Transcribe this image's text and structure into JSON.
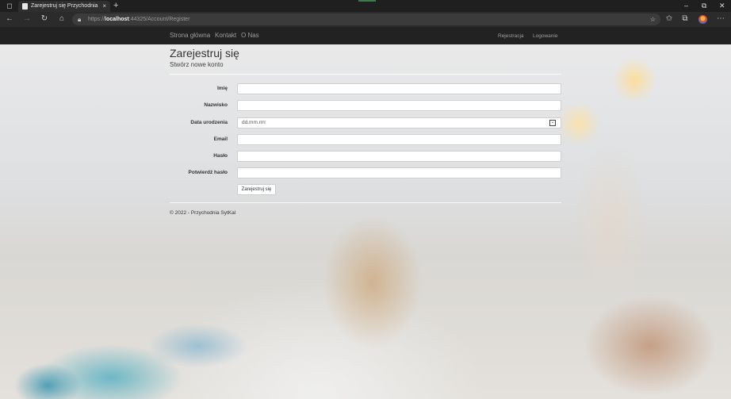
{
  "browser": {
    "tab_title": "Zarejestruj się Przychodnia SytK",
    "tab_close": "×",
    "new_tab": "+",
    "url_host": "localhost",
    "url_scheme": "https://",
    "url_rest": ":44325/Account/Register",
    "window_controls": {
      "minimize": "–",
      "maximize": "⧉",
      "close": "✕"
    }
  },
  "navbar": {
    "links": [
      "Strona główna",
      "Kontakt",
      "O Nas"
    ],
    "right_links": [
      "Rejestracja",
      "Logowanie"
    ]
  },
  "page": {
    "title": "Zarejestruj się",
    "subtitle": "Stwórz nowe konto",
    "fields": [
      {
        "label": "Imię",
        "value": ""
      },
      {
        "label": "Nazwisko",
        "value": ""
      },
      {
        "label": "Data urodzenia",
        "value": "dd.mm.rrrr"
      },
      {
        "label": "Email",
        "value": ""
      },
      {
        "label": "Hasło",
        "value": ""
      },
      {
        "label": "Potwierdź hasło",
        "value": ""
      }
    ],
    "submit_label": "Zarejestruj się",
    "footer": "© 2022 - Przychodnia SytKal"
  },
  "colors": {
    "navbar_bg": "#222222",
    "nav_link": "#9d9d9d"
  }
}
